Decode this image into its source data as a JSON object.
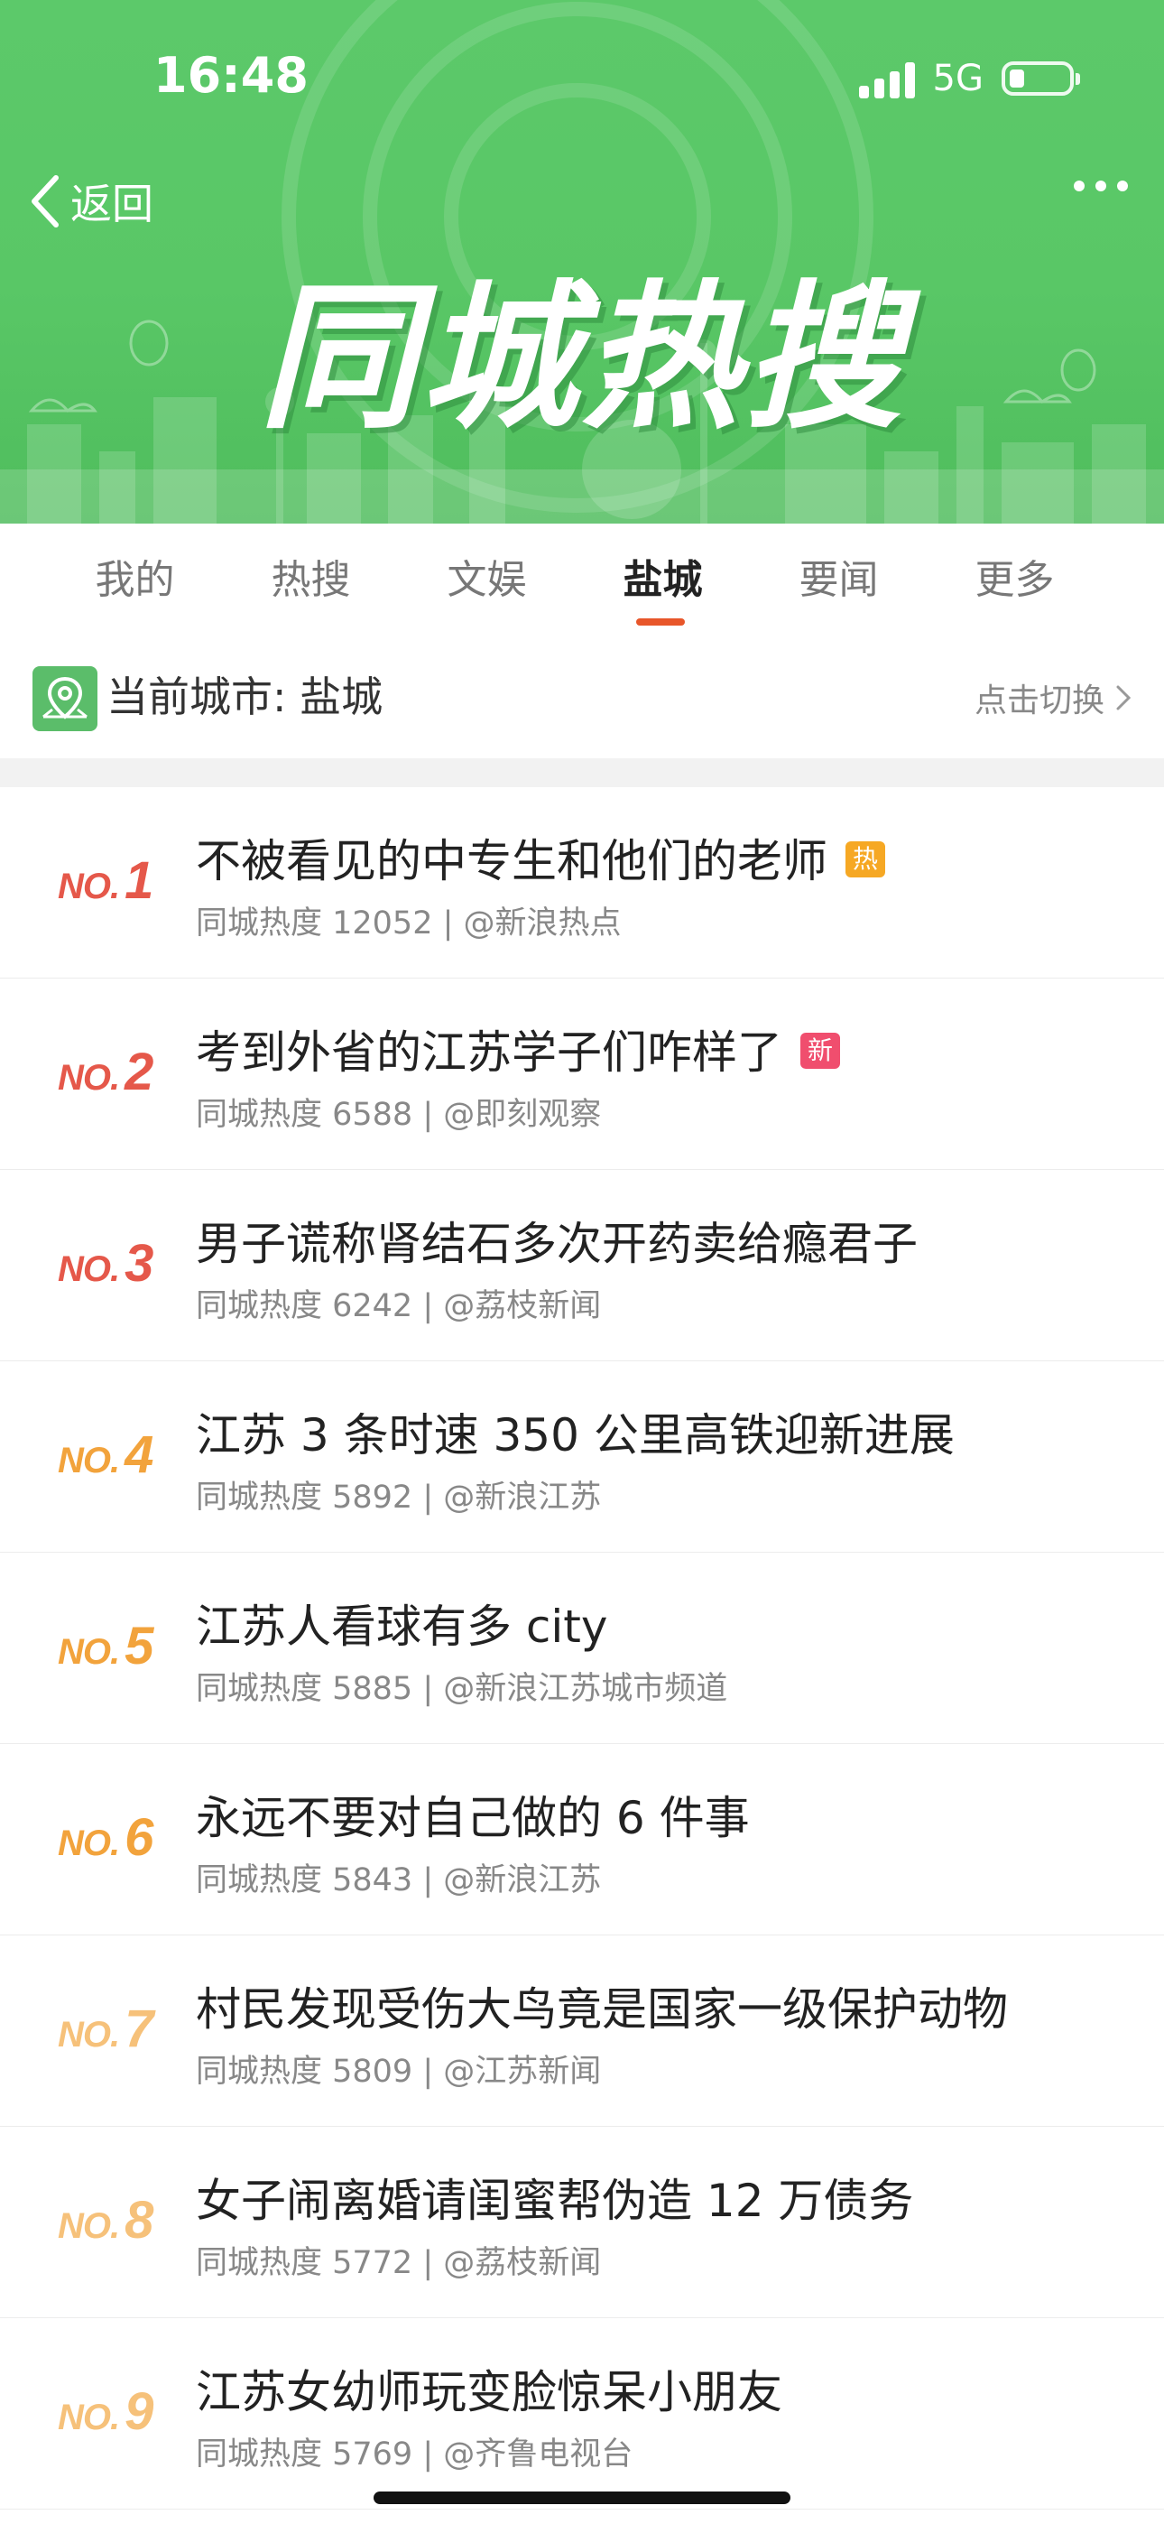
{
  "status_bar": {
    "time": "16:48",
    "network": "5G",
    "battery_level": 0.2
  },
  "header": {
    "back_label": "返回",
    "banner_title": "同城热搜",
    "background_color": "#5cc96a"
  },
  "tabs": [
    {
      "label": "我的",
      "active": false
    },
    {
      "label": "热搜",
      "active": false
    },
    {
      "label": "文娱",
      "active": false
    },
    {
      "label": "盐城",
      "active": true
    },
    {
      "label": "要闻",
      "active": false
    },
    {
      "label": "更多",
      "active": false
    }
  ],
  "city_bar": {
    "current_city": "当前城市: 盐城",
    "switch_label": "点击切换"
  },
  "rank_prefix": "NO.",
  "items": [
    {
      "rank": "1",
      "title": "不被看见的中专生和他们的老师",
      "badge": "热",
      "badge_type": "hot",
      "meta": "同城热度 12052 | @新浪热点"
    },
    {
      "rank": "2",
      "title": "考到外省的江苏学子们咋样了",
      "badge": "新",
      "badge_type": "new",
      "meta": "同城热度 6588 | @即刻观察"
    },
    {
      "rank": "3",
      "title": "男子谎称肾结石多次开药卖给瘾君子",
      "badge": "",
      "badge_type": "",
      "meta": "同城热度 6242 | @荔枝新闻"
    },
    {
      "rank": "4",
      "title": "江苏 3 条时速 350 公里高铁迎新进展",
      "badge": "",
      "badge_type": "",
      "meta": "同城热度 5892 | @新浪江苏"
    },
    {
      "rank": "5",
      "title": "江苏人看球有多 city",
      "badge": "",
      "badge_type": "",
      "meta": "同城热度 5885 | @新浪江苏城市频道"
    },
    {
      "rank": "6",
      "title": "永远不要对自己做的 6 件事",
      "badge": "",
      "badge_type": "",
      "meta": "同城热度 5843 | @新浪江苏"
    },
    {
      "rank": "7",
      "title": "村民发现受伤大鸟竟是国家一级保护动物",
      "badge": "",
      "badge_type": "",
      "meta": "同城热度 5809 | @江苏新闻"
    },
    {
      "rank": "8",
      "title": "女子闹离婚请闺蜜帮伪造 12 万债务",
      "badge": "",
      "badge_type": "",
      "meta": "同城热度 5772 | @荔枝新闻"
    },
    {
      "rank": "9",
      "title": "江苏女幼师玩变脸惊呆小朋友",
      "badge": "",
      "badge_type": "",
      "meta": "同城热度 5769 | @齐鲁电视台"
    }
  ],
  "colors": {
    "accent": "#e8562a",
    "rank_top": "#e5584a",
    "rank_mid": "#f2a33c",
    "rank_low": "#f6c17a",
    "hot_badge": "#f6a824",
    "new_badge": "#f04e6e"
  }
}
